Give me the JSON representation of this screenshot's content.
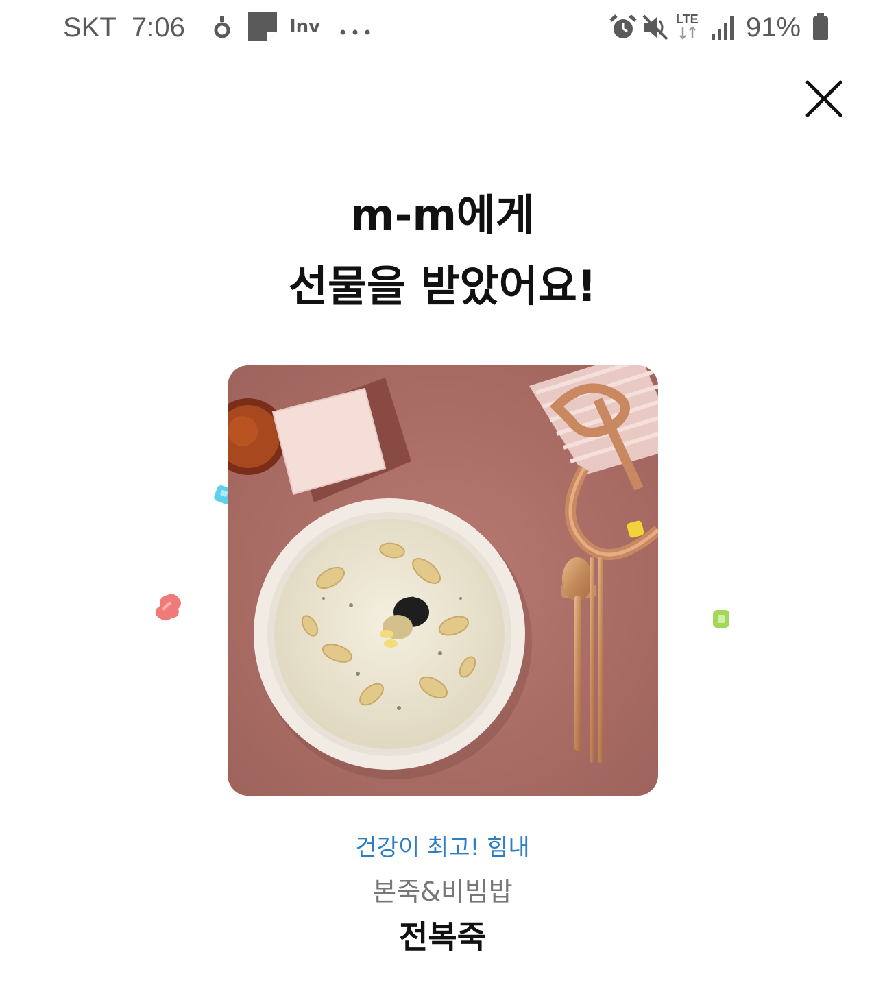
{
  "status_bar": {
    "carrier": "SKT",
    "time": "7:06",
    "app_label": "Inv",
    "network": "LTE",
    "battery_percent": "91%",
    "icons": [
      "location-icon",
      "notes-icon",
      "inv-app-icon",
      "more-notifications-icon",
      "alarm-icon",
      "mute-icon",
      "lte-icon",
      "signal-icon",
      "battery-icon"
    ]
  },
  "header": {
    "close_icon": "close-icon"
  },
  "headline": {
    "line1": "m-m에게",
    "line2": "선물을 받았어요!"
  },
  "product": {
    "image_subject": "abalone-porridge-photo",
    "gift_message": "건강이 최고! 힘내",
    "brand": "본죽&비빔밥",
    "name": "전복죽"
  },
  "colors": {
    "message_accent": "#2c7fc4",
    "brand_gray": "#777777",
    "image_background": "#b0706a"
  }
}
